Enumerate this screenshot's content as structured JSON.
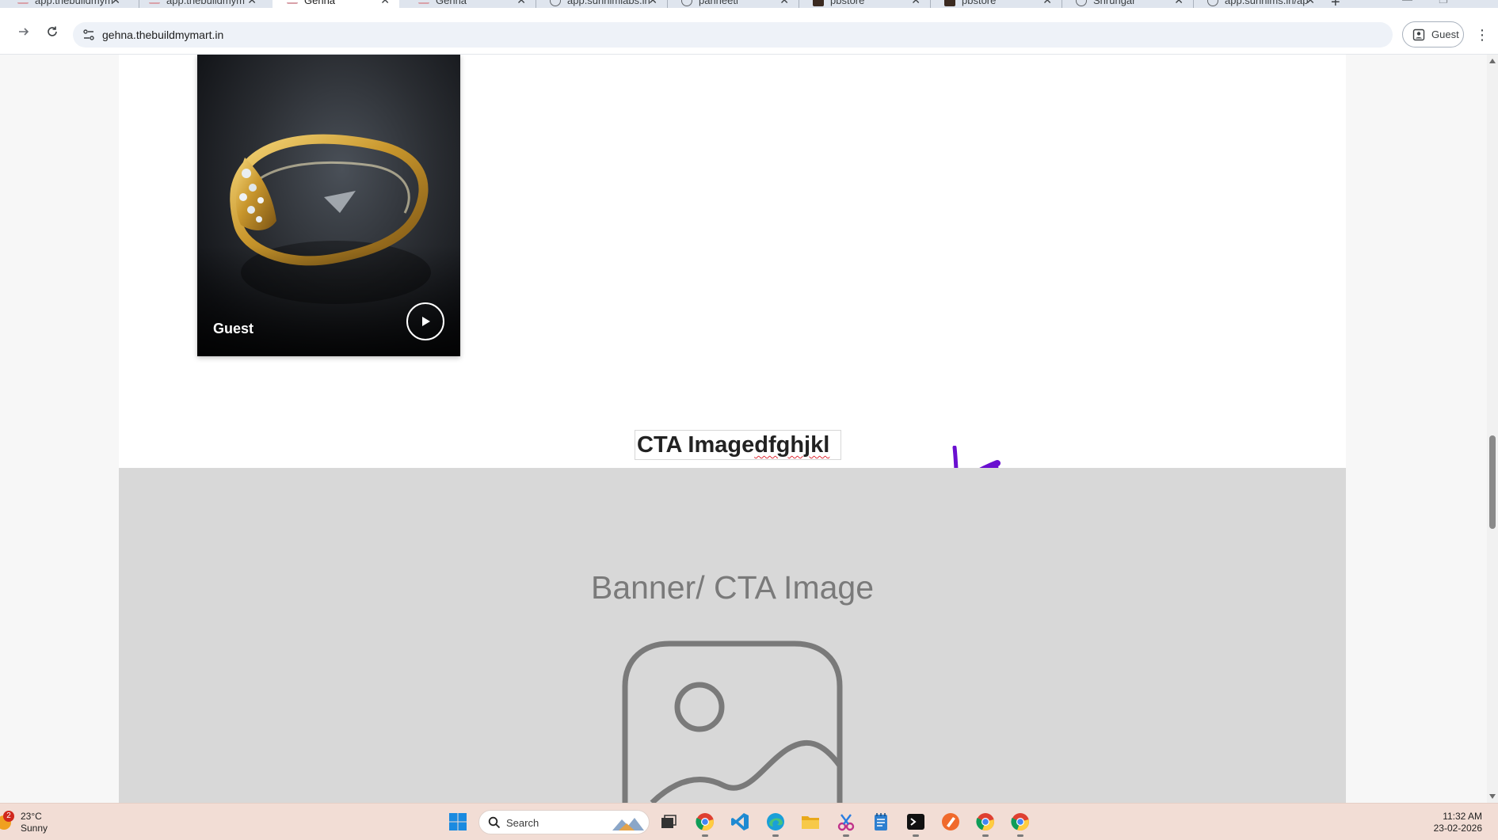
{
  "browser": {
    "tabs": [
      {
        "title": "app.thebuildmym",
        "icon": "gehna-logo-icon",
        "active": false
      },
      {
        "title": "app.thebuildmym",
        "icon": "gehna-logo-icon",
        "active": false
      },
      {
        "title": "Gehna",
        "icon": "gehna-logo-icon",
        "active": true
      },
      {
        "title": "Gehna",
        "icon": "gehna-logo-icon",
        "active": false
      },
      {
        "title": "app.sunhimlabs.in",
        "icon": "globe-icon",
        "active": false
      },
      {
        "title": "parineeti",
        "icon": "globe-icon",
        "active": false
      },
      {
        "title": "pbstore",
        "icon": "store-logo-icon",
        "active": false
      },
      {
        "title": "pbstore",
        "icon": "store-logo-icon",
        "active": false
      },
      {
        "title": "Shrungar",
        "icon": "globe-icon",
        "active": false
      },
      {
        "title": "app.sunhims.in/ap",
        "icon": "globe-icon",
        "active": false
      }
    ],
    "close_glyph": "✕",
    "new_tab_glyph": "+",
    "url": "gehna.thebuildmymart.in",
    "profile_label": "Guest"
  },
  "page": {
    "video_card": {
      "caption": "Guest"
    },
    "cta_heading": {
      "plain": "CTA Image",
      "misspelled": "dfghjkl"
    },
    "banner": {
      "title": "Banner/ CTA Image",
      "placeholder_icon": "image-placeholder-icon"
    }
  },
  "taskbar": {
    "weather": {
      "badge": "2",
      "temperature": "23°C",
      "condition": "Sunny"
    },
    "search_label": "Search",
    "apps": [
      "windows-start-icon",
      "task-view-icon",
      "chrome-icon",
      "vscode-icon",
      "edge-icon",
      "file-explorer-icon",
      "snipping-tool-icon",
      "notepad-icon",
      "terminal-icon",
      "sketch-app-icon",
      "chrome-icon",
      "chrome-icon"
    ],
    "time": "11:32 AM",
    "date": "23-02-2026"
  },
  "colors": {
    "tab_strip": "#dfe5ee",
    "omnibox": "#eef2f8",
    "banner_bg": "#d8d8d8",
    "cursor_mark": "#6a0fd0",
    "taskbar_bg": "#f2ddd5",
    "spellcheck_underline": "#e0303a"
  }
}
